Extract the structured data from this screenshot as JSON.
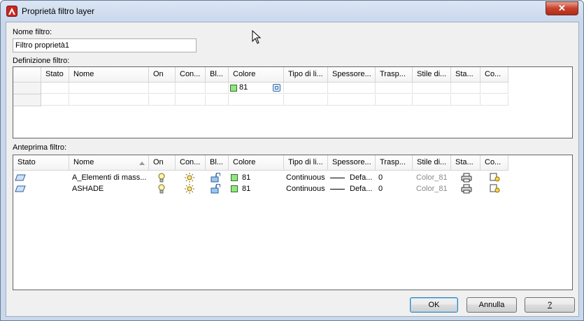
{
  "window": {
    "title": "Proprietà filtro layer",
    "close_label": "✕"
  },
  "filter_name": {
    "label": "Nome filtro:",
    "value": "Filtro proprietà1"
  },
  "definition": {
    "label": "Definizione filtro:",
    "headers": [
      "Stato",
      "Nome",
      "On",
      "Con...",
      "Bl...",
      "Colore",
      "Tipo di li...",
      "Spessore...",
      "Trasp...",
      "Stile di...",
      "Sta...",
      "Co..."
    ],
    "row": {
      "color_value": "81"
    }
  },
  "preview": {
    "label": "Anteprima filtro:",
    "headers": [
      "Stato",
      "Nome",
      "On",
      "Con...",
      "Bl...",
      "Colore",
      "Tipo di li...",
      "Spessore...",
      "Trasp...",
      "Stile di...",
      "Sta...",
      "Co..."
    ],
    "rows": [
      {
        "name": "A_Elementi di mass...",
        "color": "81",
        "linetype": "Continuous",
        "lineweight": "Defa...",
        "transparency": "0",
        "plot_style": "Color_81"
      },
      {
        "name": "ASHADE",
        "color": "81",
        "linetype": "Continuous",
        "lineweight": "Defa...",
        "transparency": "0",
        "plot_style": "Color_81"
      }
    ]
  },
  "buttons": {
    "ok": "OK",
    "cancel": "Annulla",
    "help": "?"
  },
  "colors": {
    "swatch": "#8ee87c",
    "accent": "#3c7fb1",
    "close": "#c7412b"
  }
}
